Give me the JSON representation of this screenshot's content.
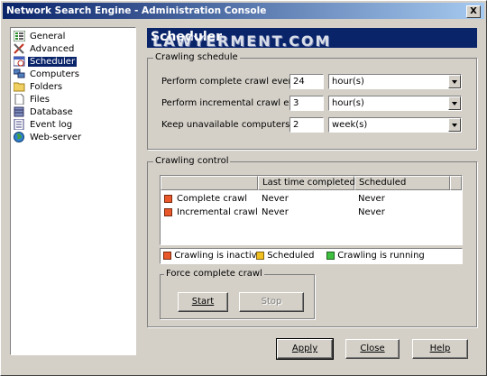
{
  "window": {
    "title": "Network Search Engine - Administration Console",
    "close_glyph": "X"
  },
  "sidebar": {
    "items": [
      {
        "label": "General",
        "icon": "general-icon",
        "selected": false
      },
      {
        "label": "Advanced",
        "icon": "tools-icon",
        "selected": false
      },
      {
        "label": "Scheduler",
        "icon": "scheduler-icon",
        "selected": true
      },
      {
        "label": "Computers",
        "icon": "computers-icon",
        "selected": false
      },
      {
        "label": "Folders",
        "icon": "folder-icon",
        "selected": false
      },
      {
        "label": "Files",
        "icon": "file-icon",
        "selected": false
      },
      {
        "label": "Database",
        "icon": "database-icon",
        "selected": false
      },
      {
        "label": "Event log",
        "icon": "event-log-icon",
        "selected": false
      },
      {
        "label": "Web-server",
        "icon": "globe-icon",
        "selected": false
      }
    ]
  },
  "header": {
    "title": "Scheduler",
    "watermark": "LAWYERMENT.COM"
  },
  "crawling_schedule": {
    "legend": "Crawling schedule",
    "rows": [
      {
        "label": "Perform complete crawl every",
        "value": "24",
        "unit": "hour(s)"
      },
      {
        "label": "Perform incremental crawl every",
        "value": "3",
        "unit": "hour(s)"
      },
      {
        "label": "Keep unavailable computers for",
        "value": "2",
        "unit": "week(s)"
      }
    ]
  },
  "crawling_control": {
    "legend": "Crawling control",
    "columns": [
      "",
      "Last time completed",
      "Scheduled"
    ],
    "rows": [
      {
        "name": "Complete crawl",
        "last": "Never",
        "scheduled": "Never"
      },
      {
        "name": "Incremental crawl",
        "last": "Never",
        "scheduled": "Never"
      }
    ],
    "status_legend": [
      {
        "label": "Crawling is inactive",
        "color": "#e8582a"
      },
      {
        "label": "Scheduled",
        "color": "#f0c020"
      },
      {
        "label": "Crawling is running",
        "color": "#40c040"
      }
    ],
    "force": {
      "legend": "Force complete crawl",
      "start": "Start",
      "stop": "Stop"
    }
  },
  "buttons": {
    "apply": "Apply",
    "close": "Close",
    "help": "Help"
  },
  "colors": {
    "title_bar": "#0a246a",
    "selection": "#0a246a",
    "inactive_status": "#e8582a"
  }
}
